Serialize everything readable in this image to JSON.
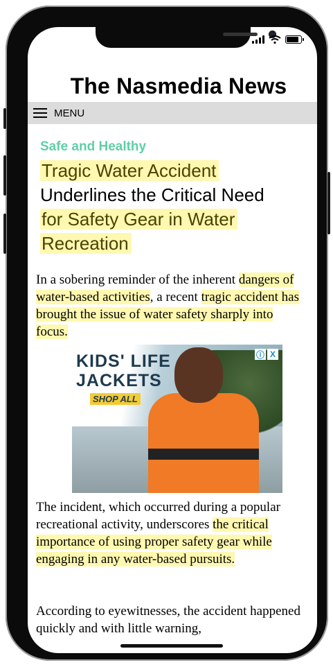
{
  "site": {
    "title": "The Nasmedia News"
  },
  "nav": {
    "menu_label": "MENU"
  },
  "article": {
    "category": "Safe and Healthy",
    "headline": {
      "line1": "Tragic Water Accident",
      "line2": "Underlines the Critical Need",
      "line3": "for Safety Gear in Water",
      "line4": "Recreation"
    },
    "p1": {
      "a": "In a sobering reminder of the inherent ",
      "b": "dangers of water-based activities",
      "c": ", a recent ",
      "d": "tragic accident has brought the issue of water safety sharply into focus."
    },
    "p2": {
      "a": "The incident, which occurred during a popular recreational activity, underscores ",
      "b": "the critical importance of using proper safety gear while engaging in any water-based pursuits."
    },
    "p3": {
      "a": "According to eyewitnesses, the accident happened quickly and with little warning,"
    }
  },
  "ad": {
    "title_line1": "KIDS' LIFE",
    "title_line2": "JACKETS",
    "cta": "SHOP ALL",
    "info_glyph": "ⓘ",
    "close_glyph": "X"
  },
  "colors": {
    "category": "#5fcfa6",
    "highlight": "#fff8b0",
    "menu_bar": "#dcdcdc"
  }
}
